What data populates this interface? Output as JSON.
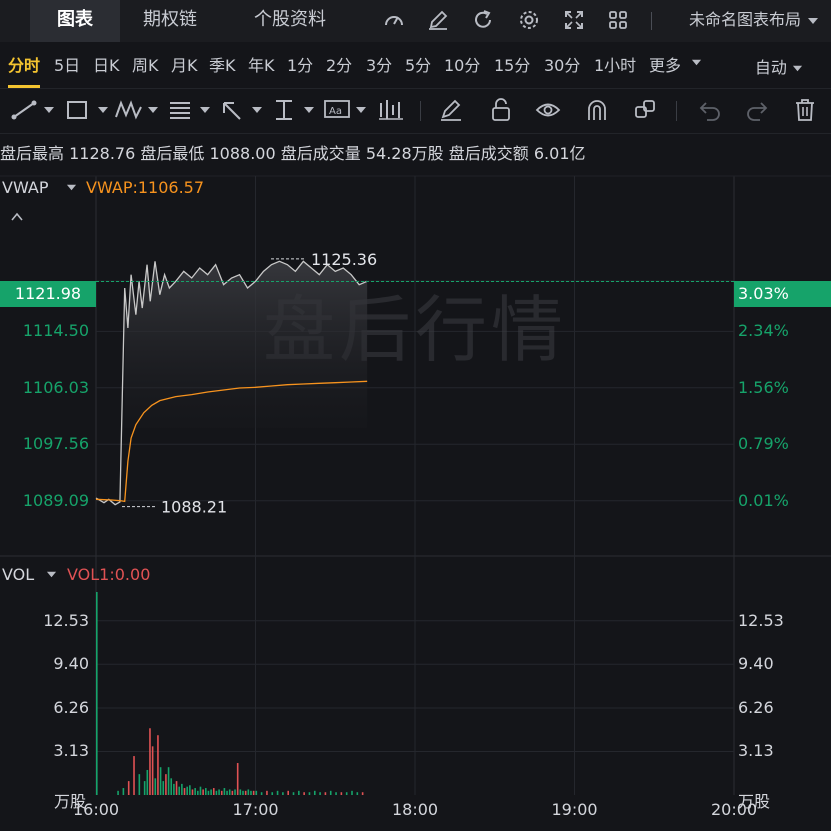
{
  "nav": {
    "tabs": [
      {
        "label": "图表",
        "active": true
      },
      {
        "label": "期权链",
        "active": false
      },
      {
        "label": "个股资料",
        "active": false
      }
    ],
    "icons": [
      "gauge-icon",
      "pencil-icon",
      "refresh-icon",
      "gear-icon",
      "fullscreen-icon",
      "grid-icon"
    ],
    "layout_name": "未命名图表布局"
  },
  "periods": {
    "items": [
      "分时",
      "5日",
      "日K",
      "周K",
      "月K",
      "季K",
      "年K",
      "1分",
      "2分",
      "3分",
      "5分",
      "10分",
      "15分",
      "30分",
      "1小时",
      "更多"
    ],
    "active": "分时",
    "mode": "自动"
  },
  "tools": [
    "line-tool-icon",
    "rect-tool-icon",
    "wave-tool-icon",
    "text-tool-icon",
    "arrow-tool-icon",
    "measure-tool-icon",
    "label-tool-icon",
    "indicator-tool-icon",
    "brush-icon",
    "lock-icon",
    "eye-icon",
    "magnet-icon",
    "copy-icon",
    "undo-icon",
    "redo-icon",
    "trash-icon"
  ],
  "info": {
    "high_label": "盘后最高",
    "high_value": "1128.76",
    "low_label": "盘后最低",
    "low_value": "1088.00",
    "vol_label": "盘后成交量",
    "vol_value": "54.28万股",
    "amt_label": "盘后成交额",
    "amt_value": "6.01亿"
  },
  "watermark": "盘后行情",
  "colors": {
    "bg": "#141519",
    "up": "#16a36a",
    "down": "#e05254",
    "vwap": "#f7931e",
    "price_line": "#c8c8c8"
  },
  "chart_data": [
    {
      "type": "line",
      "indicator_name": "VWAP",
      "indicator_value": "VWAP:1106.57",
      "current_price": "1121.98",
      "current_pct": "3.03%",
      "high_mark": "1125.36",
      "low_mark": "1088.21",
      "y_ticks": [
        1114.5,
        1106.03,
        1097.56,
        1089.09
      ],
      "y_tick_labels": [
        "1114.50",
        "1106.03",
        "1097.56",
        "1089.09"
      ],
      "pct_tick_labels": [
        "2.34%",
        "1.56%",
        "0.79%",
        "0.01%"
      ],
      "ylim": [
        1082,
        1136
      ],
      "xlim_hours": [
        16.0,
        20.0
      ],
      "x_tick_labels": [
        "16:00",
        "17:00",
        "18:00",
        "19:00",
        "20:00"
      ],
      "series": [
        {
          "key": "price",
          "x": [
            16.0,
            16.05,
            16.08,
            16.12,
            16.15,
            16.18,
            16.2,
            16.22,
            16.25,
            16.27,
            16.29,
            16.32,
            16.34,
            16.37,
            16.4,
            16.43,
            16.46,
            16.5,
            16.55,
            16.6,
            16.65,
            16.7,
            16.75,
            16.8,
            16.85,
            16.9,
            16.95,
            17.0,
            17.05,
            17.1,
            17.15,
            17.2,
            17.25,
            17.3,
            17.35,
            17.4,
            17.45,
            17.5,
            17.55,
            17.6,
            17.65,
            17.7
          ],
          "y": [
            1089.5,
            1088.8,
            1089.3,
            1088.5,
            1088.9,
            1121.0,
            1115.0,
            1123.0,
            1117.0,
            1122.0,
            1118.0,
            1124.5,
            1119.0,
            1125.0,
            1120.0,
            1123.0,
            1121.0,
            1122.0,
            1123.5,
            1122.5,
            1124.0,
            1123.0,
            1124.5,
            1121.5,
            1122.5,
            1123.0,
            1121.0,
            1122.0,
            1123.5,
            1124.5,
            1125.0,
            1124.5,
            1123.5,
            1125.0,
            1124.0,
            1123.0,
            1124.5,
            1123.5,
            1124.0,
            1123.0,
            1121.5,
            1122.0
          ]
        },
        {
          "key": "vwap",
          "x": [
            16.0,
            16.1,
            16.15,
            16.18,
            16.2,
            16.22,
            16.25,
            16.3,
            16.35,
            16.4,
            16.5,
            16.6,
            16.7,
            16.8,
            16.9,
            17.0,
            17.1,
            17.2,
            17.3,
            17.4,
            17.5,
            17.6,
            17.7
          ],
          "y": [
            1089.3,
            1089.2,
            1089.1,
            1089.0,
            1095.0,
            1098.5,
            1100.5,
            1102.3,
            1103.4,
            1104.1,
            1104.7,
            1105.0,
            1105.4,
            1105.7,
            1106.0,
            1106.1,
            1106.3,
            1106.5,
            1106.6,
            1106.7,
            1106.8,
            1106.9,
            1107.0
          ]
        }
      ]
    },
    {
      "type": "bar",
      "indicator_name": "VOL",
      "indicator_value": "VOL1:0.00",
      "unit": "万股",
      "y_ticks": [
        12.53,
        9.4,
        6.26,
        3.13
      ],
      "y_tick_labels": [
        "12.53",
        "9.40",
        "6.26",
        "3.13"
      ],
      "ylim": [
        0,
        14.6
      ],
      "x_minutes": [
        0,
        8,
        10,
        12,
        14,
        16,
        18,
        19,
        20,
        21,
        22,
        23,
        24,
        25,
        26,
        27,
        28,
        29,
        30,
        31,
        32,
        33,
        34,
        35,
        36,
        37,
        38,
        39,
        40,
        41,
        42,
        43,
        44,
        45,
        46,
        47,
        48,
        49,
        50,
        51,
        52,
        53,
        54,
        55,
        56,
        57,
        58,
        59,
        60,
        62,
        64,
        66,
        68,
        70,
        72,
        74,
        76,
        78,
        80,
        82,
        84,
        86,
        88,
        90,
        92,
        94,
        96,
        98,
        100
      ],
      "values": [
        14.6,
        0.3,
        0.5,
        1.0,
        2.8,
        1.5,
        1.0,
        1.8,
        4.8,
        3.5,
        1.2,
        4.3,
        2.0,
        1.0,
        1.5,
        2.0,
        1.2,
        0.8,
        1.0,
        0.6,
        0.8,
        0.5,
        0.6,
        0.7,
        0.4,
        0.5,
        0.3,
        0.6,
        0.4,
        0.5,
        0.3,
        0.4,
        0.5,
        0.3,
        0.4,
        0.3,
        0.5,
        0.3,
        0.4,
        0.3,
        0.4,
        2.3,
        0.4,
        0.3,
        0.3,
        0.4,
        0.3,
        0.3,
        0.3,
        0.2,
        0.3,
        0.2,
        0.3,
        0.2,
        0.3,
        0.2,
        0.3,
        0.2,
        0.2,
        0.3,
        0.2,
        0.2,
        0.3,
        0.2,
        0.2,
        0.2,
        0.3,
        0.2,
        0.2
      ],
      "colors": [
        "up",
        "up",
        "up",
        "down",
        "down",
        "up",
        "up",
        "up",
        "down",
        "down",
        "up",
        "down",
        "up",
        "up",
        "down",
        "up",
        "up",
        "up",
        "down",
        "up",
        "up",
        "down",
        "up",
        "up",
        "down",
        "up",
        "up",
        "up",
        "down",
        "up",
        "up",
        "up",
        "down",
        "up",
        "up",
        "down",
        "up",
        "up",
        "up",
        "down",
        "up",
        "down",
        "up",
        "up",
        "down",
        "up",
        "up",
        "down",
        "up",
        "up",
        "down",
        "up",
        "up",
        "up",
        "down",
        "up",
        "up",
        "down",
        "up",
        "up",
        "up",
        "down",
        "up",
        "up",
        "down",
        "up",
        "up",
        "up",
        "down"
      ]
    }
  ]
}
